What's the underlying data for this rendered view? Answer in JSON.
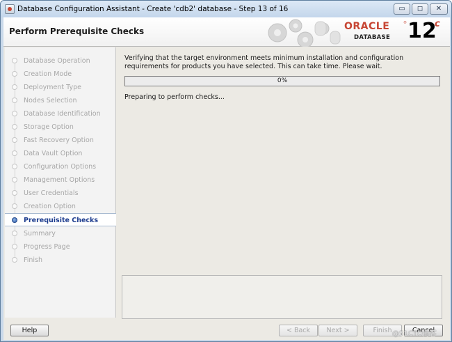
{
  "window": {
    "title": "Database Configuration Assistant - Create 'cdb2' database - Step 13 of 16",
    "controls": {
      "minimize": "▭",
      "maximize": "◻",
      "close": "✕"
    }
  },
  "header": {
    "page_title": "Perform Prerequisite Checks",
    "brand": {
      "oracle": "ORACLE",
      "registered": "®",
      "database": "DATABASE",
      "version": "12",
      "version_suffix": "c"
    }
  },
  "sidebar": {
    "steps": [
      {
        "label": "Database Operation",
        "state": "done"
      },
      {
        "label": "Creation Mode",
        "state": "done"
      },
      {
        "label": "Deployment Type",
        "state": "done"
      },
      {
        "label": "Nodes Selection",
        "state": "done"
      },
      {
        "label": "Database Identification",
        "state": "done"
      },
      {
        "label": "Storage Option",
        "state": "done"
      },
      {
        "label": "Fast Recovery Option",
        "state": "done"
      },
      {
        "label": "Data Vault Option",
        "state": "done"
      },
      {
        "label": "Configuration Options",
        "state": "done"
      },
      {
        "label": "Management Options",
        "state": "done"
      },
      {
        "label": "User Credentials",
        "state": "done"
      },
      {
        "label": "Creation Option",
        "state": "done"
      },
      {
        "label": "Prerequisite Checks",
        "state": "current"
      },
      {
        "label": "Summary",
        "state": "pending"
      },
      {
        "label": "Progress Page",
        "state": "pending"
      },
      {
        "label": "Finish",
        "state": "pending"
      }
    ]
  },
  "main": {
    "verify_text": "Verifying that the target environment meets minimum installation and configuration requirements for products you have selected. This can take time. Please wait.",
    "progress": {
      "label": "0%",
      "value": 0
    },
    "status_text": "Preparing to perform checks..."
  },
  "buttons": {
    "help": "Help",
    "back": "< Back",
    "next": "Next >",
    "finish": "Finish",
    "cancel": "Cancel"
  },
  "watermark": "@51CTO博客",
  "colors": {
    "oracle_red": "#c74634",
    "current_step": "#1e3d8f",
    "progress_fill": "#7da3d6"
  }
}
